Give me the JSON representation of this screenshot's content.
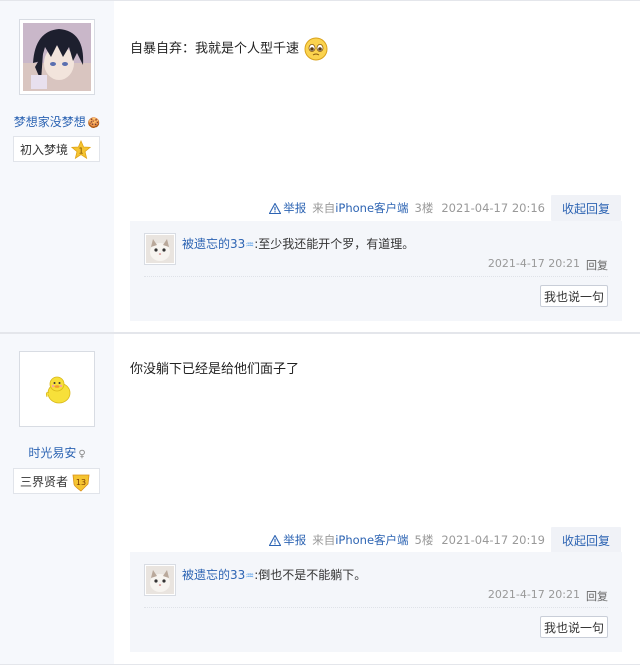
{
  "posts": [
    {
      "username": "梦想家没梦想",
      "user_badge": "🍪",
      "level_name": "初入梦境",
      "level_num": "1",
      "content": "自暴自弃：我就是个人型千速",
      "tail": {
        "report": "举报",
        "from_prefix": "来自",
        "client": "iPhone客户端",
        "floor": "3楼",
        "time": "2021-04-17 20:16",
        "reply_toggle": "收起回复"
      },
      "replies": [
        {
          "user": "被遗忘的33",
          "user_vip": "♒",
          "text": ":至少我还能开个罗，有道理。",
          "time": "2021-4-17 20:21",
          "reply": "回复"
        }
      ],
      "say_button": "我也说一句"
    },
    {
      "username": "时光易安",
      "user_badge": "♀",
      "level_name": "三界贤者",
      "level_num": "13",
      "content": "你没躺下已经是给他们面子了",
      "tail": {
        "report": "举报",
        "from_prefix": "来自",
        "client": "iPhone客户端",
        "floor": "5楼",
        "time": "2021-04-17 20:19",
        "reply_toggle": "收起回复"
      },
      "replies": [
        {
          "user": "被遗忘的33",
          "user_vip": "♒",
          "text": ":倒也不是不能躺下。",
          "time": "2021-4-17 20:21",
          "reply": "回复"
        }
      ],
      "say_button": "我也说一句"
    }
  ],
  "colors": {
    "link": "#2d64b3",
    "sidebar_bg": "#f6f8fc",
    "reply_bg": "#f4f6fa"
  }
}
